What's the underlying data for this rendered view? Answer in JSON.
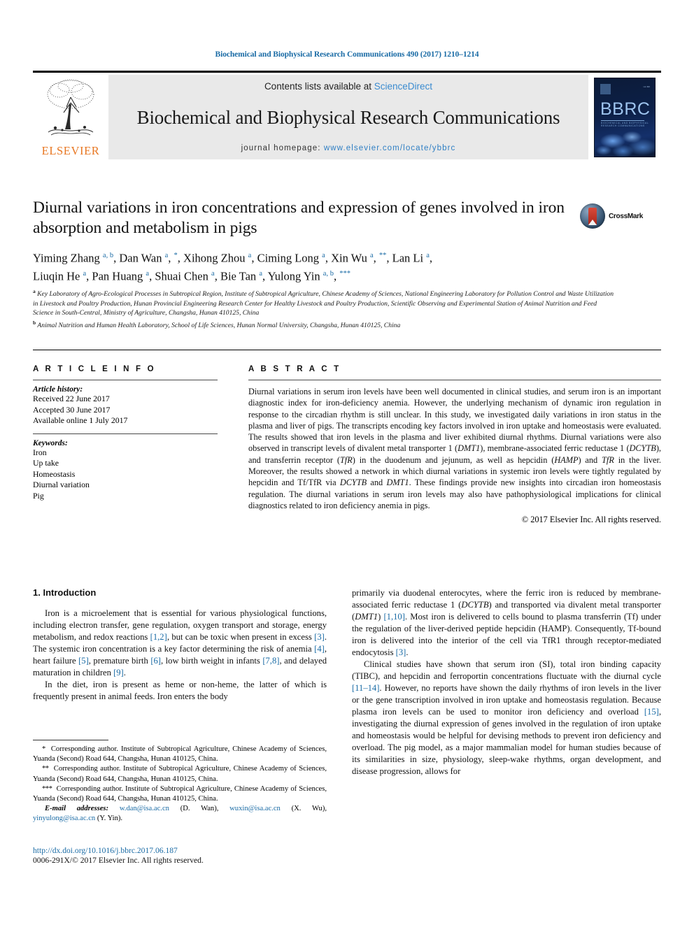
{
  "running_head": "Biochemical and Biophysical Research Communications 490 (2017) 1210–1214",
  "masthead": {
    "contents_prefix": "Contents lists available at ",
    "sciencedirect": "ScienceDirect",
    "journal_title": "Biochemical and Biophysical Research Communications",
    "homepage_prefix": "journal homepage: ",
    "homepage_url": "www.elsevier.com/locate/ybbrc",
    "publisher_name": "ELSEVIER",
    "cover_title": "BBRC",
    "cover_subtitle": "BIOCHEMICAL AND BIOPHYSICAL RESEARCH COMMUNICATIONS",
    "accent_link_color": "#3a8bd0",
    "panel_background": "#e9e9e9"
  },
  "article": {
    "title": "Diurnal variations in iron concentrations and expression of genes involved in iron absorption and metabolism in pigs",
    "crossmark_label": "CrossMark",
    "authors_line1_html": "Yiming Zhang <sup>a, b</sup>, Dan Wan <sup>a</sup>, <sup class=\"star\">*</sup>, Xihong Zhou <sup>a</sup>, Ciming Long <sup>a</sup>, Xin Wu <sup>a</sup>, <sup class=\"star\">**</sup>, Lan Li <sup>a</sup>,",
    "authors_line2_html": "Liuqin He <sup>a</sup>, Pan Huang <sup>a</sup>, Shuai Chen <sup>a</sup>, Bie Tan <sup>a</sup>, Yulong Yin <sup>a, b</sup>, <sup class=\"star\">***</sup>",
    "affiliation_a": "Key Laboratory of Agro-Ecological Processes in Subtropical Region, Institute of Subtropical Agriculture, Chinese Academy of Sciences, National Engineering Laboratory for Pollution Control and Waste Utilization in Livestock and Poultry Production, Hunan Provincial Engineering Research Center for Healthy Livestock and Poultry Production, Scientific Observing and Experimental Station of Animal Nutrition and Feed Science in South-Central, Ministry of Agriculture, Changsha, Hunan 410125, China",
    "affiliation_b": "Animal Nutrition and Human Health Laboratory, School of Life Sciences, Hunan Normal University, Changsha, Hunan 410125, China"
  },
  "article_info": {
    "heading": "A R T I C L E   I N F O",
    "history_label": "Article history:",
    "received": "Received 22 June 2017",
    "accepted": "Accepted 30 June 2017",
    "available_online": "Available online 1 July 2017",
    "keywords_label": "Keywords:",
    "keywords": [
      "Iron",
      "Up take",
      "Homeostasis",
      "Diurnal variation",
      "Pig"
    ]
  },
  "abstract": {
    "heading": "A B S T R A C T",
    "text_html": "Diurnal variations in serum iron levels have been well documented in clinical studies, and serum iron is an important diagnostic index for iron-deficiency anemia. However, the underlying mechanism of dynamic iron regulation in response to the circadian rhythm is still unclear. In this study, we investigated daily variations in iron status in the plasma and liver of pigs. The transcripts encoding key factors involved in iron uptake and homeostasis were evaluated. The results showed that iron levels in the plasma and liver exhibited diurnal rhythms. Diurnal variations were also observed in transcript levels of divalent metal transporter 1 (<i>DMT1</i>), membrane-associated ferric reductase 1 (<i>DCYTB</i>), and transferrin receptor (<i>TfR</i>) in the duodenum and jejunum, as well as hepcidin (<i>HAMP</i>) and <i>TfR</i> in the liver. Moreover, the results showed a network in which diurnal variations in systemic iron levels were tightly regulated by hepcidin and Tf/TfR via <i>DCYTB</i> and <i>DMT1</i>. These findings provide new insights into circadian iron homeostasis regulation. The diurnal variations in serum iron levels may also have pathophysiological implications for clinical diagnostics related to iron deficiency anemia in pigs.",
    "copyright": "© 2017 Elsevier Inc. All rights reserved."
  },
  "body": {
    "section1_heading": "1.  Introduction",
    "left_p1_html": "Iron is a microelement that is essential for various physiological functions, including electron transfer, gene regulation, oxygen transport and storage, energy metabolism, and redox reactions <span class=\"ref\">[1,2]</span>, but can be toxic when present in excess <span class=\"ref\">[3]</span>. The systemic iron concentration is a key factor determining the risk of anemia <span class=\"ref\">[4]</span>, heart failure <span class=\"ref\">[5]</span>, premature birth <span class=\"ref\">[6]</span>, low birth weight in infants <span class=\"ref\">[7,8]</span>, and delayed maturation in children <span class=\"ref\">[9]</span>.",
    "left_p2_html": "In the diet, iron is present as heme or non-heme, the latter of which is frequently present in animal feeds. Iron enters the body",
    "right_p1_html": "primarily via duodenal enterocytes, where the ferric iron is reduced by membrane-associated ferric reductase 1 (<i>DCYTB</i>) and transported via divalent metal transporter (<i>DMT1</i>) <span class=\"ref\">[1,10]</span>. Most iron is delivered to cells bound to plasma transferrin (Tf) under the regulation of the liver-derived peptide hepcidin (HAMP). Consequently, Tf-bound iron is delivered into the interior of the cell via TfR1 through receptor-mediated endocytosis <span class=\"ref\">[3]</span>.",
    "right_p2_html": "Clinical studies have shown that serum iron (SI), total iron binding capacity (TIBC), and hepcidin and ferroportin concentrations fluctuate with the diurnal cycle <span class=\"ref\">[11–14]</span>. However, no reports have shown the daily rhythms of iron levels in the liver or the gene transcription involved in iron uptake and homeostasis regulation. Because plasma iron levels can be used to monitor iron deficiency and overload <span class=\"ref\">[15]</span>, investigating the diurnal expression of genes involved in the regulation of iron uptake and homeostasis would be helpful for devising methods to prevent iron deficiency and overload. The pig model, as a major mammalian model for human studies because of its similarities in size, physiology, sleep-wake rhythms, organ development, and disease progression, allows for"
  },
  "footnotes": {
    "fn1_html": "<span class=\"mark\">*</span>&nbsp; Corresponding author. Institute of Subtropical Agriculture, Chinese Academy of Sciences, Yuanda (Second) Road 644, Changsha, Hunan 410125, China.",
    "fn2_html": "<span class=\"mark\">**</span>&nbsp; Corresponding author. Institute of Subtropical Agriculture, Chinese Academy of Sciences, Yuanda (Second) Road 644, Changsha, Hunan 410125, China.",
    "fn3_html": "<span class=\"mark\">***</span>&nbsp; Corresponding author. Institute of Subtropical Agriculture, Chinese Academy of Sciences, Yuanda (Second) Road 644, Changsha, Hunan 410125, China.",
    "email_html": "<i>E-mail addresses:</i> <span class=\"link\">w.dan@isa.ac.cn</span> (D. Wan), <span class=\"link\">wuxin@isa.ac.cn</span> (X. Wu), <span class=\"link\">yinyulong@isa.ac.cn</span> (Y. Yin)."
  },
  "footer": {
    "doi": "http://dx.doi.org/10.1016/j.bbrc.2017.06.187",
    "issn_line": "0006-291X/© 2017 Elsevier Inc. All rights reserved."
  }
}
